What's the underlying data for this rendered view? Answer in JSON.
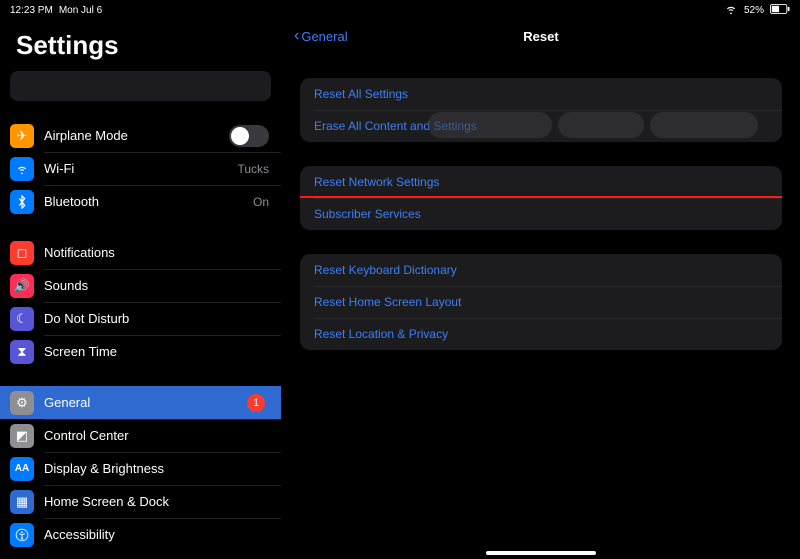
{
  "status": {
    "time": "12:23 PM",
    "date": "Mon Jul 6",
    "battery_percent": "52%"
  },
  "sidebar": {
    "title": "Settings",
    "items": {
      "airplane": "Airplane Mode",
      "wifi": "Wi-Fi",
      "wifi_value": "Tucks",
      "bluetooth": "Bluetooth",
      "bluetooth_value": "On",
      "notifications": "Notifications",
      "sounds": "Sounds",
      "dnd": "Do Not Disturb",
      "screen_time": "Screen Time",
      "general": "General",
      "general_badge": "1",
      "control_center": "Control Center",
      "display": "Display & Brightness",
      "home_screen": "Home Screen & Dock",
      "accessibility": "Accessibility"
    }
  },
  "main": {
    "back_label": "General",
    "title": "Reset",
    "group1": {
      "reset_all": "Reset All Settings",
      "erase_all": "Erase All Content and Settings"
    },
    "group2": {
      "reset_network": "Reset Network Settings",
      "subscriber": "Subscriber Services"
    },
    "group3": {
      "reset_keyboard": "Reset Keyboard Dictionary",
      "reset_home": "Reset Home Screen Layout",
      "reset_location": "Reset Location & Privacy"
    }
  }
}
